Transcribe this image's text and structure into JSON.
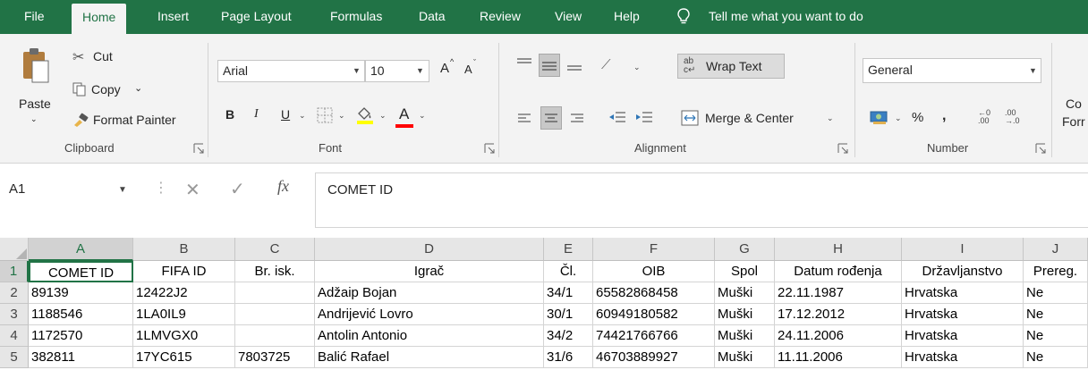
{
  "ribbon_tabs": [
    "File",
    "Home",
    "Insert",
    "Page Layout",
    "Formulas",
    "Data",
    "Review",
    "View",
    "Help"
  ],
  "tell_me": "Tell me what you want to do",
  "clipboard": {
    "paste": "Paste",
    "cut": "Cut",
    "copy": "Copy",
    "format_painter": "Format Painter",
    "label": "Clipboard"
  },
  "font": {
    "name": "Arial",
    "size": "10",
    "bold": "B",
    "italic": "I",
    "underline": "U",
    "label": "Font",
    "grow": "A",
    "shrink": "A",
    "font_color_letter": "A"
  },
  "alignment": {
    "wrap_text": "Wrap Text",
    "merge_center": "Merge & Center",
    "label": "Alignment"
  },
  "number": {
    "format": "General",
    "percent": "%",
    "comma": ",",
    "label": "Number",
    "cond_format_partial_1": "Co",
    "cond_format_partial_2": "Forr"
  },
  "formula_bar": {
    "name_box": "A1",
    "fx": "fx",
    "content": "COMET ID"
  },
  "columns": [
    "A",
    "B",
    "C",
    "D",
    "E",
    "F",
    "G",
    "H",
    "I",
    "J"
  ],
  "rows": [
    {
      "n": "1",
      "cells": [
        "COMET ID",
        "FIFA ID",
        "Br. isk.",
        "Igrač",
        "Čl.",
        "OIB",
        "Spol",
        "Datum rođenja",
        "Državljanstvo",
        "Prereg."
      ]
    },
    {
      "n": "2",
      "cells": [
        "89139",
        "12422J2",
        "",
        "Adžaip Bojan",
        "34/1",
        "65582868458",
        "Muški",
        "22.11.1987",
        "Hrvatska",
        "Ne"
      ]
    },
    {
      "n": "3",
      "cells": [
        "1188546",
        "1LA0IL9",
        "",
        "Andrijević Lovro",
        "30/1",
        "60949180582",
        "Muški",
        "17.12.2012",
        "Hrvatska",
        "Ne"
      ]
    },
    {
      "n": "4",
      "cells": [
        "1172570",
        "1LMVGX0",
        "",
        "Antolin Antonio",
        "34/2",
        "74421766766",
        "Muški",
        "24.11.2006",
        "Hrvatska",
        "Ne"
      ]
    },
    {
      "n": "5",
      "cells": [
        "382811",
        "17YC615",
        "7803725",
        "Balić Rafael",
        "31/6",
        "46703889927",
        "Muški",
        "11.11.2006",
        "Hrvatska",
        "Ne"
      ]
    }
  ],
  "colors": {
    "accent": "#217346",
    "highlight_yellow": "#ffff00",
    "font_red": "#ff0000"
  }
}
